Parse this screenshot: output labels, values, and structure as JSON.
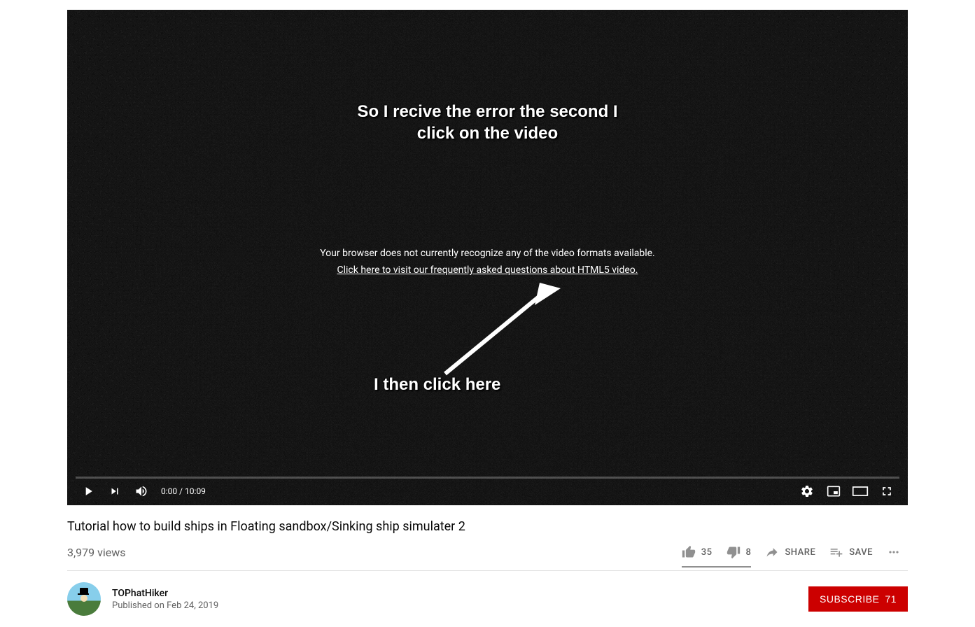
{
  "player": {
    "annotation_top": "So I recive the error the second I\nclick on the video",
    "error_line1": "Your browser does not currently recognize any of the video formats available.",
    "error_link": "Click here to visit our frequently asked questions about HTML5 video.",
    "annotation_bottom": "I then click here",
    "current_time": "0:00",
    "separator": " / ",
    "duration": "10:09"
  },
  "video": {
    "title": "Tutorial how to build ships in Floating sandbox/Sinking ship simulater 2",
    "views": "3,979 views",
    "likes": "35",
    "dislikes": "8",
    "share_label": "SHARE",
    "save_label": "SAVE"
  },
  "channel": {
    "name": "TOPhatHiker",
    "published": "Published on Feb 24, 2019",
    "subscribe_label": "SUBSCRIBE",
    "subscriber_count": "71"
  }
}
